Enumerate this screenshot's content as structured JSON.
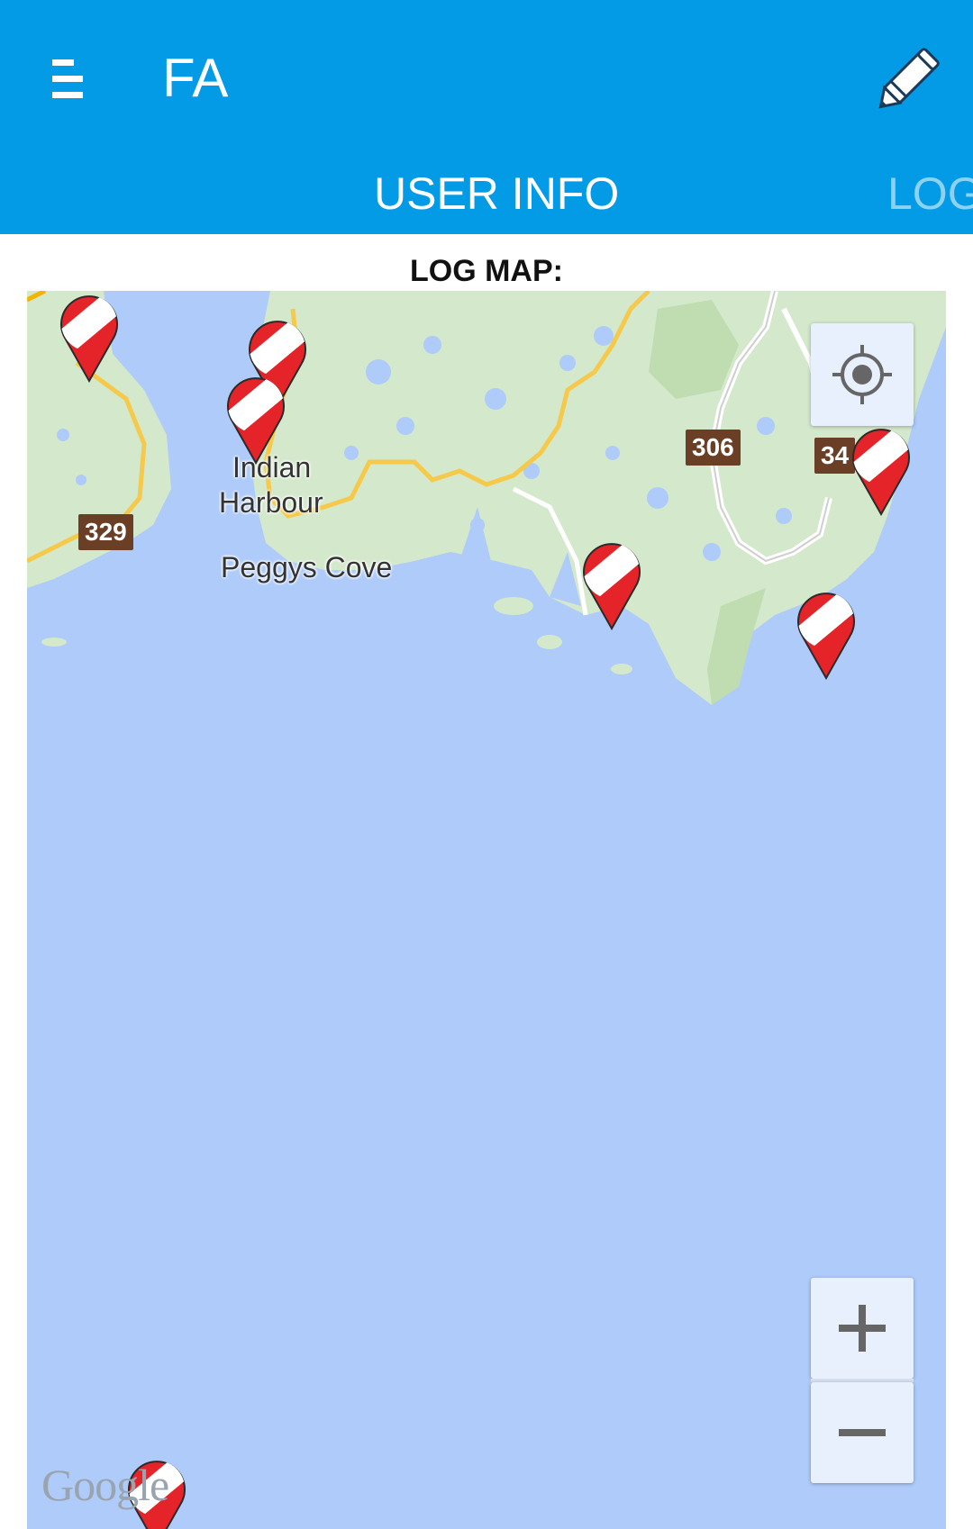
{
  "app_bar": {
    "title": "FA",
    "menu_icon": "hamburger-menu-icon",
    "edit_icon": "pencil-icon",
    "background": "#039BE5"
  },
  "tabs": [
    {
      "label": "USER INFO",
      "selected": true
    },
    {
      "label": "LOG",
      "selected": false
    }
  ],
  "section_title": "LOG MAP:",
  "map": {
    "place_labels": [
      "Indian",
      "Harbour",
      "Peggys Cove"
    ],
    "route_shields": [
      "329",
      "306",
      "34"
    ],
    "attribution": "Google",
    "marker_icon": "dive-flag-marker-icon",
    "controls": {
      "locate_icon": "my-location-icon",
      "zoom_in_label": "+",
      "zoom_out_label": "−"
    },
    "colors": {
      "water": "#AECBFA",
      "land": "#D4E8CC",
      "marker": "#E5242A",
      "route_shield": "#6B3E26"
    }
  }
}
